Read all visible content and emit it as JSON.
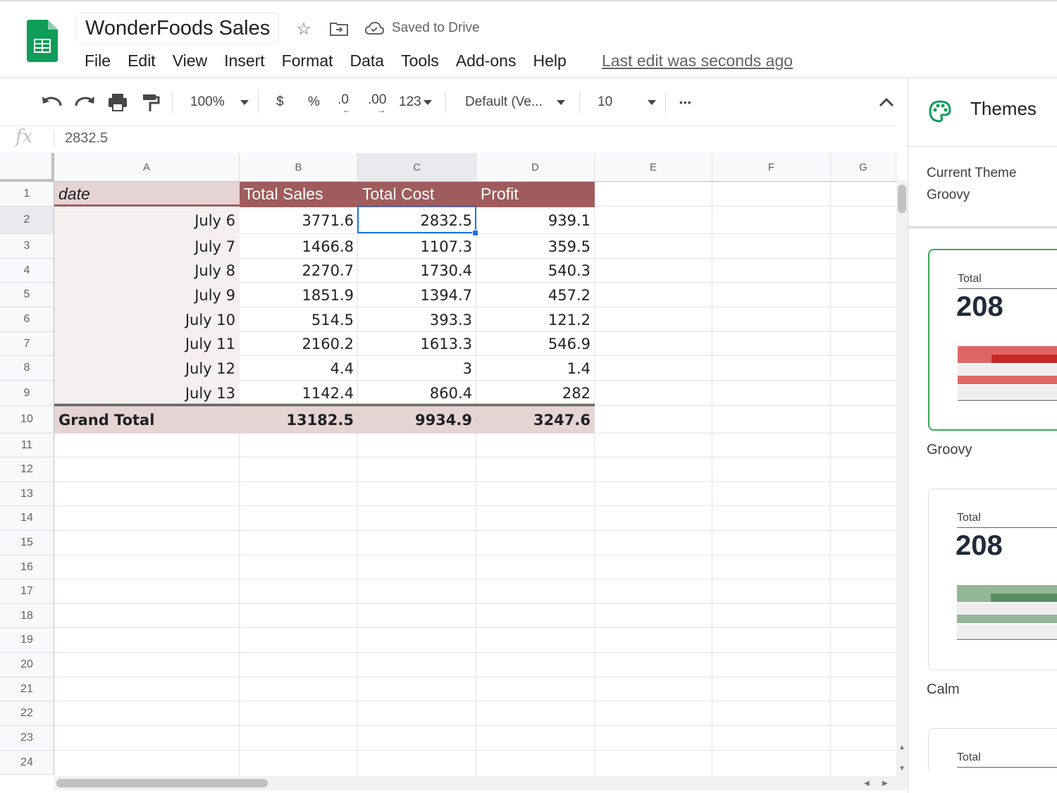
{
  "header": {
    "doc_title": "WonderFoods Sales",
    "saved_status": "Saved to Drive",
    "last_edit": "Last edit was seconds ago",
    "menu": [
      "File",
      "Edit",
      "View",
      "Insert",
      "Format",
      "Data",
      "Tools",
      "Add-ons",
      "Help"
    ]
  },
  "toolbar": {
    "zoom": "100%",
    "currency": "$",
    "percent": "%",
    "decrease_decimal": ".0",
    "increase_decimal": ".00",
    "more_formats": "123",
    "font": "Default (Ve...",
    "font_size": "10",
    "more": "•••"
  },
  "formula_bar": {
    "fx": "fx",
    "value": "2832.5"
  },
  "sheet": {
    "columns": [
      "A",
      "B",
      "C",
      "D",
      "E",
      "F",
      "G"
    ],
    "selected_column": "C",
    "rows": [
      "1",
      "2",
      "3",
      "4",
      "5",
      "6",
      "7",
      "8",
      "9",
      "10",
      "11",
      "12",
      "13",
      "14",
      "15",
      "16",
      "17",
      "18",
      "19",
      "20",
      "21",
      "22",
      "23",
      "24"
    ],
    "selected_row": "2",
    "headers": [
      "date",
      "Total Sales",
      "Total Cost",
      "Profit"
    ],
    "data": [
      [
        "July 6",
        "3771.6",
        "2832.5",
        "939.1"
      ],
      [
        "July 7",
        "1466.8",
        "1107.3",
        "359.5"
      ],
      [
        "July 8",
        "2270.7",
        "1730.4",
        "540.3"
      ],
      [
        "July 9",
        "1851.9",
        "1394.7",
        "457.2"
      ],
      [
        "July 10",
        "514.5",
        "393.3",
        "121.2"
      ],
      [
        "July 11",
        "2160.2",
        "1613.3",
        "546.9"
      ],
      [
        "July 12",
        "4.4",
        "3",
        "1.4"
      ],
      [
        "July 13",
        "1142.4",
        "860.4",
        "282"
      ]
    ],
    "grand_total": [
      "Grand Total",
      "13182.5",
      "9934.9",
      "3247.6"
    ],
    "colors": {
      "header_bg": "#a05c5c",
      "header_date_bg": "#e6d4d4",
      "date_col_bg": "#f5efef",
      "total_bg": "#e6d4d4",
      "selection": "#1a73e8"
    }
  },
  "themes_panel": {
    "title": "Themes",
    "current_label": "Current Theme",
    "current_name": "Groovy",
    "themes": [
      {
        "name": "Groovy",
        "preview_label": "Total",
        "preview_value": "208",
        "accent": "#d45a5a",
        "accent_dark": "#c62828"
      },
      {
        "name": "Calm",
        "preview_label": "Total",
        "preview_value": "208",
        "accent": "#86ac8a",
        "accent_dark": "#5a8f63"
      },
      {
        "name": "",
        "preview_label": "Total",
        "preview_value": "",
        "accent": "",
        "accent_dark": ""
      }
    ]
  }
}
